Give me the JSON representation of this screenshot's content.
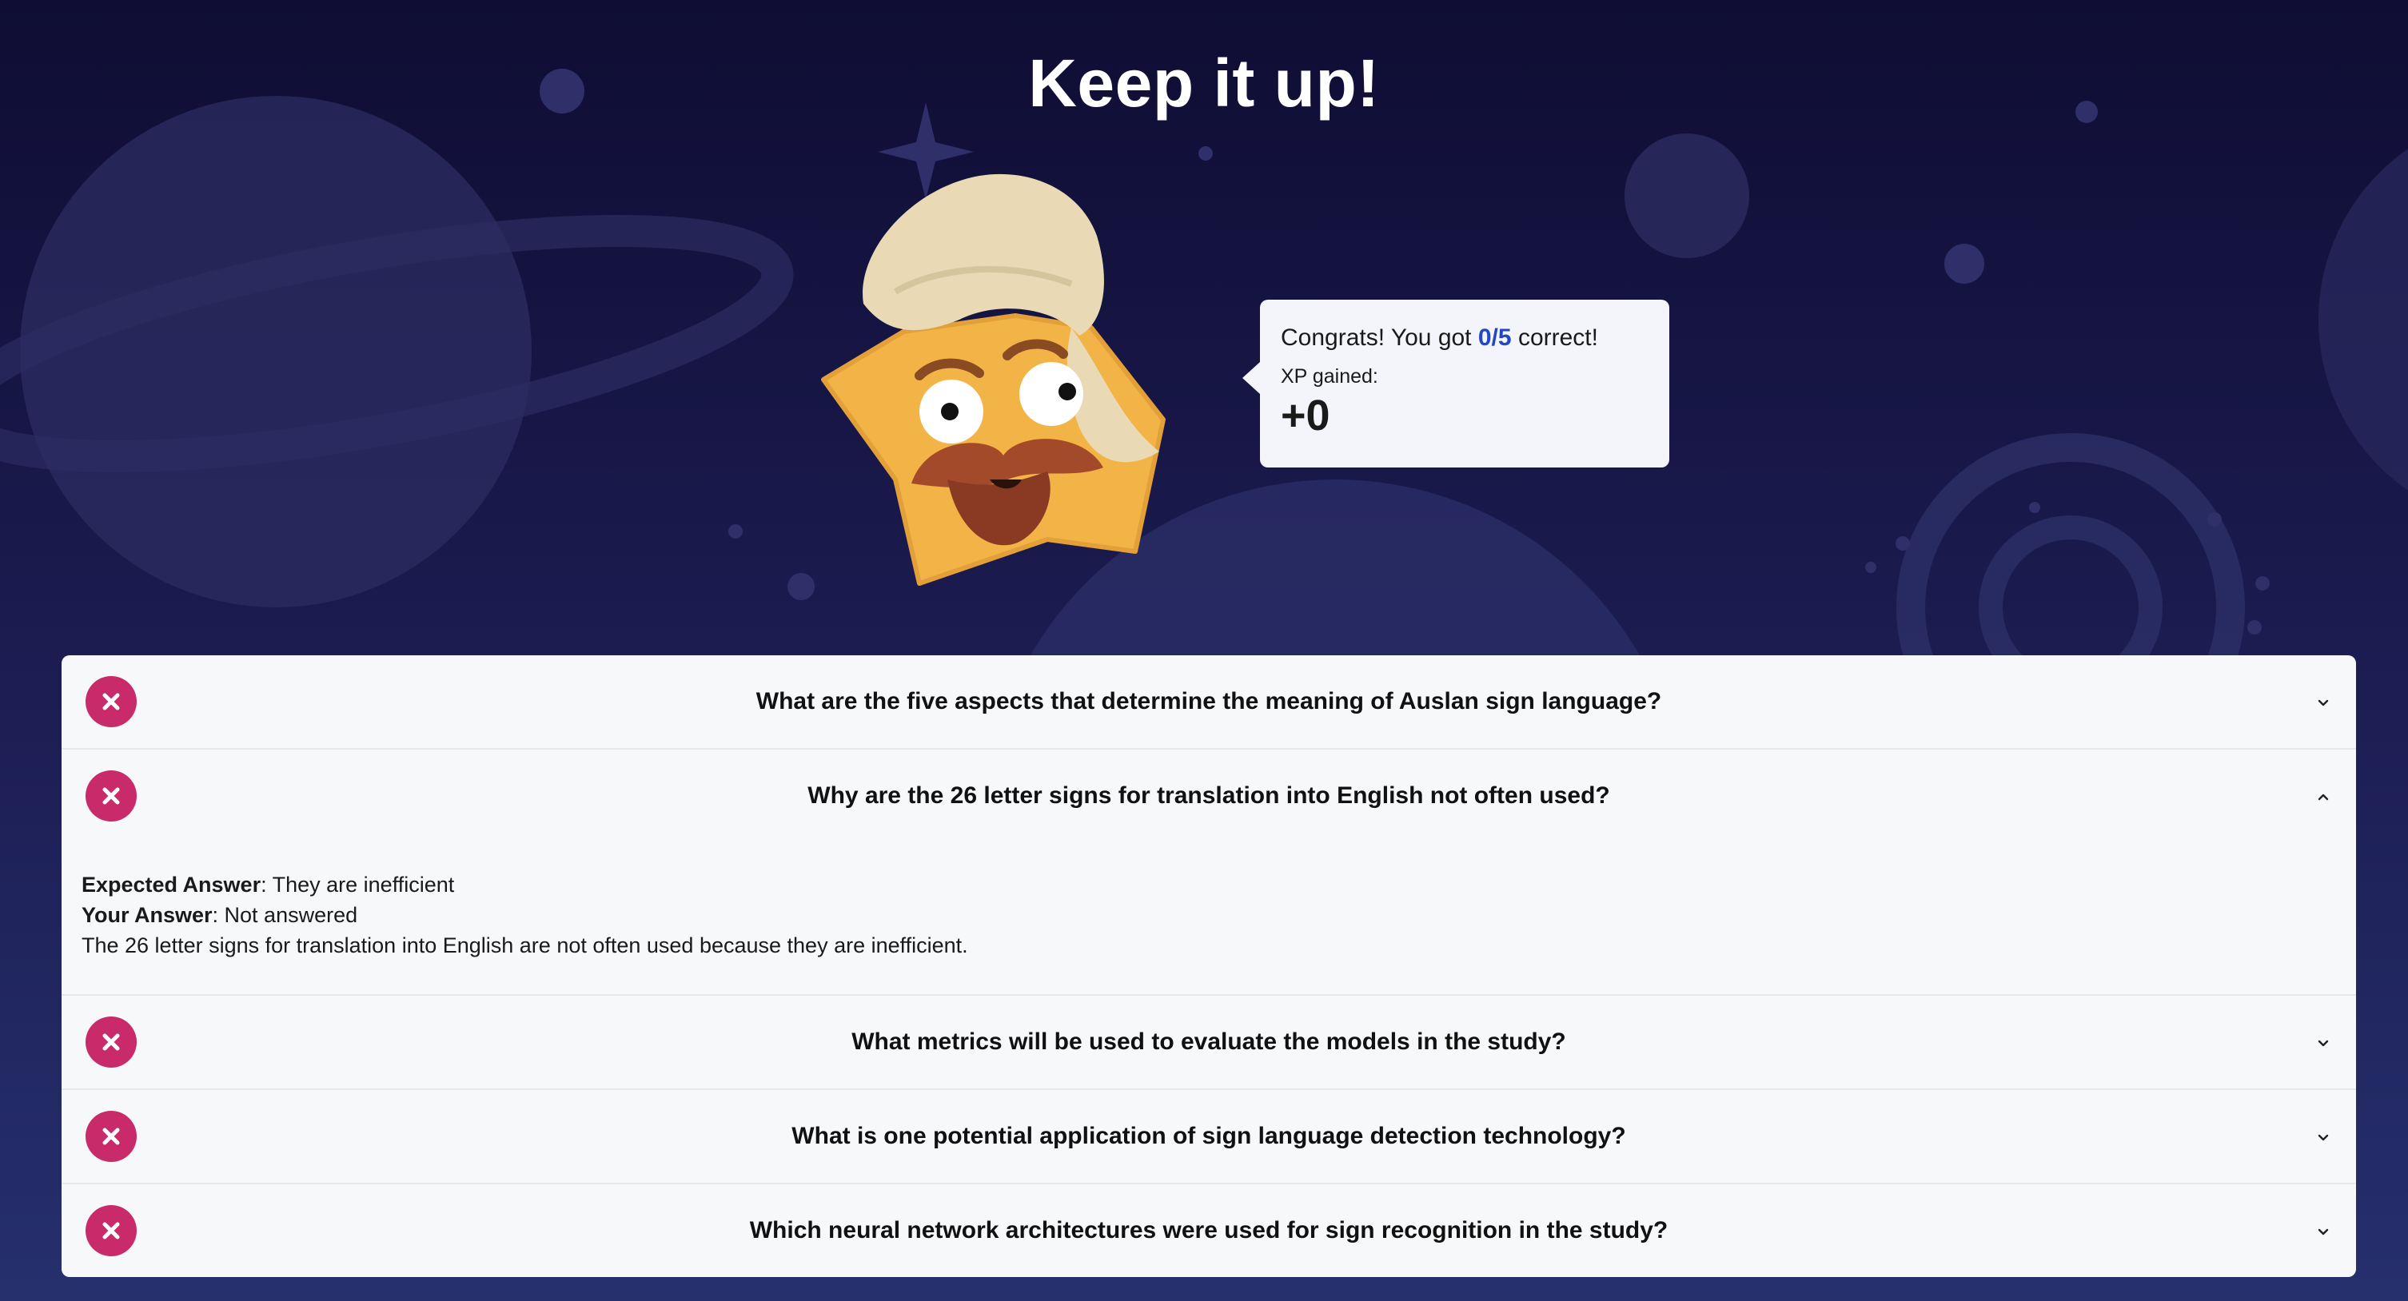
{
  "title": "Keep it up!",
  "result": {
    "congrats_prefix": "Congrats! You got",
    "score": "0/5",
    "congrats_suffix": "correct!",
    "xp_label": "XP gained:",
    "xp_value": "+0"
  },
  "questions": [
    {
      "text": "What are the five aspects that determine the meaning of Auslan sign language?",
      "status": "incorrect",
      "expanded": false
    },
    {
      "text": "Why are the 26 letter signs for translation into English not often used?",
      "status": "incorrect",
      "expanded": true
    },
    {
      "text": "What metrics will be used to evaluate the models in the study?",
      "status": "incorrect",
      "expanded": false
    },
    {
      "text": "What is one potential application of sign language detection technology?",
      "status": "incorrect",
      "expanded": false
    },
    {
      "text": "Which neural network architectures were used for sign recognition in the study?",
      "status": "incorrect",
      "expanded": false
    }
  ],
  "expanded_answer": {
    "expected_label": "Expected Answer",
    "expected_value": ": They are inefficient",
    "your_label": "Your Answer",
    "your_value": ": Not answered",
    "explanation": "The 26 letter signs for translation into English are not often used because they are inefficient."
  },
  "icons": {
    "incorrect": "x-circle-icon",
    "collapsed": "chevron-down-icon",
    "expanded": "chevron-up-icon"
  },
  "colors": {
    "background_top": "#0f0d33",
    "background_bottom": "#26306d",
    "incorrect_badge": "#c82a6a",
    "score_accent": "#2347c4",
    "panel": "#f7f8fa"
  }
}
